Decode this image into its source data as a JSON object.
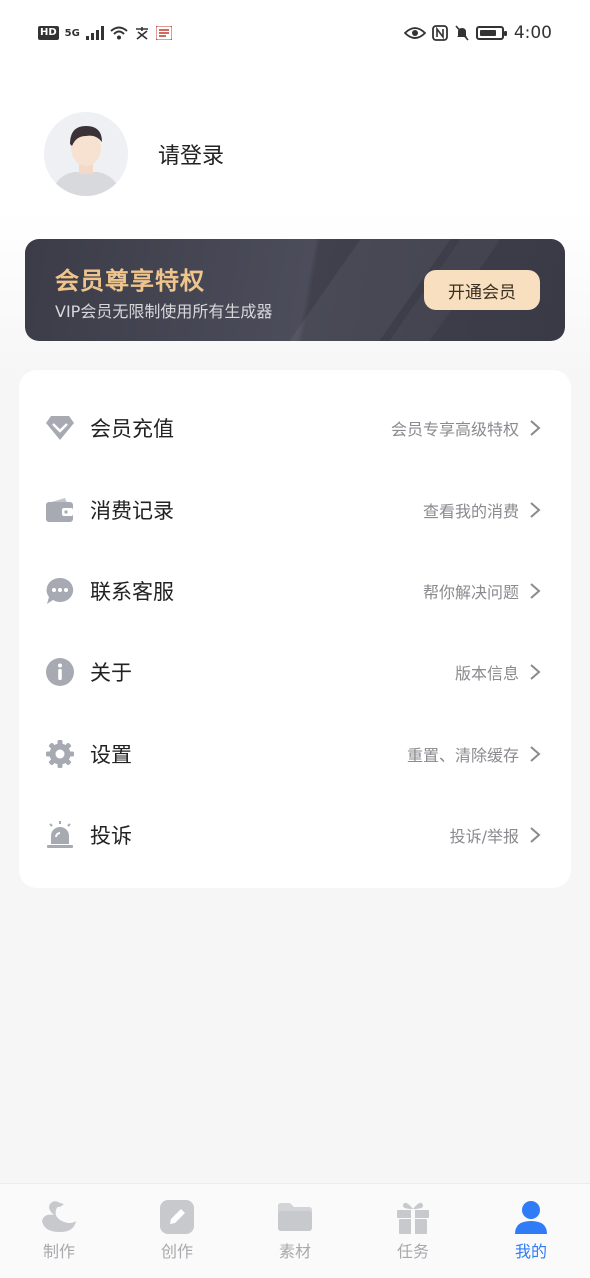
{
  "status_bar": {
    "left_chips": [
      "HD",
      "5G"
    ],
    "time": "4:00"
  },
  "profile": {
    "login_text": "请登录"
  },
  "vip": {
    "title": "会员尊享特权",
    "subtitle": "VIP会员无限制使用所有生成器",
    "button": "开通会员"
  },
  "menu": [
    {
      "icon": "diamond-icon",
      "label": "会员充值",
      "hint": "会员专享高级特权"
    },
    {
      "icon": "wallet-icon",
      "label": "消费记录",
      "hint": "查看我的消费"
    },
    {
      "icon": "chat-icon",
      "label": "联系客服",
      "hint": "帮你解决问题"
    },
    {
      "icon": "info-icon",
      "label": "关于",
      "hint": "版本信息"
    },
    {
      "icon": "gear-icon",
      "label": "设置",
      "hint": "重置、清除缓存"
    },
    {
      "icon": "alarm-icon",
      "label": "投诉",
      "hint": "投诉/举报"
    }
  ],
  "bottom_nav": [
    {
      "icon": "swan-icon",
      "label": "制作",
      "active": false
    },
    {
      "icon": "edit-icon",
      "label": "创作",
      "active": false
    },
    {
      "icon": "folder-icon",
      "label": "素材",
      "active": false
    },
    {
      "icon": "gift-icon",
      "label": "任务",
      "active": false
    },
    {
      "icon": "user-icon",
      "label": "我的",
      "active": true
    }
  ],
  "colors": {
    "accent": "#2f7cf6",
    "vip_gold": "#f0c58d",
    "icon_gray": "#a7aab3"
  }
}
